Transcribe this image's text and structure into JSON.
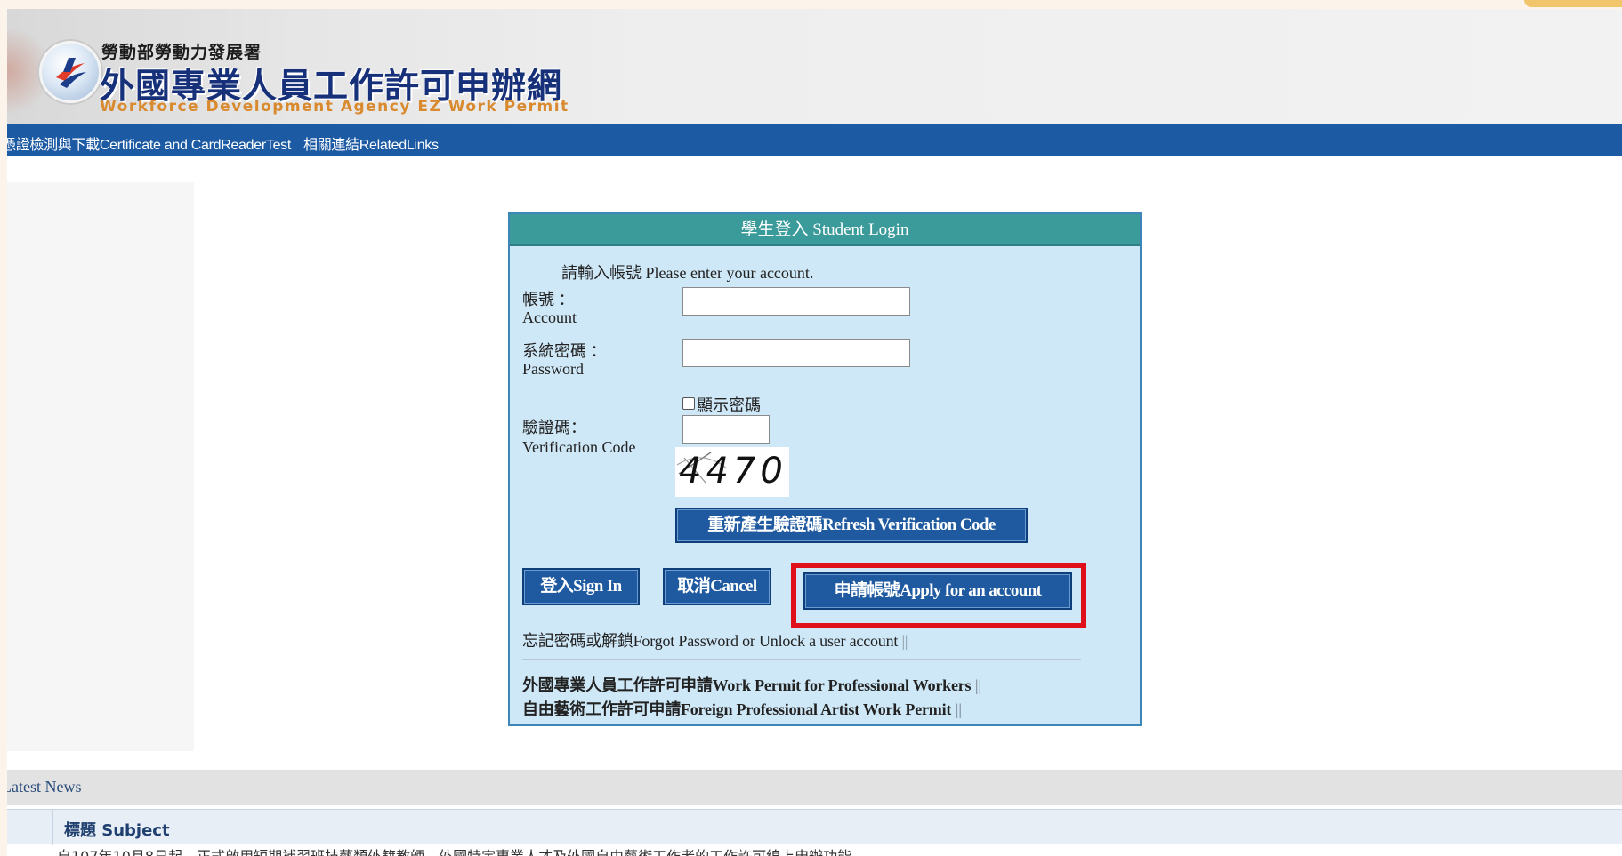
{
  "header": {
    "agency_name": "勞動部勞動力發展署",
    "site_title": "外國專業人員工作許可申辦網",
    "site_subtitle": "Workforce Development Agency EZ Work Permit"
  },
  "nav": {
    "certificate_link": "憑證檢測與下載Certificate and CardReaderTest",
    "related_links": "相關連結RelatedLinks"
  },
  "login": {
    "header": "學生登入 Student Login",
    "prompt": "請輸入帳號 Please enter your account.",
    "account_label_zh": "帳號 ：",
    "account_label_en": "Account",
    "account_value": "",
    "password_label_zh": "系統密碼 ：",
    "password_label_en": "Password",
    "password_value": "",
    "show_password_label": "顯示密碼",
    "verification_label_zh": "驗證碼：",
    "verification_label_en": "Verification Code",
    "verification_value": "",
    "captcha_text": "4470",
    "refresh_button": "重新產生驗證碼Refresh Verification Code",
    "sign_in_button": "登入Sign In",
    "cancel_button": "取消Cancel",
    "apply_button": "申請帳號Apply for an account",
    "forgot_password_link": "忘記密碼或解鎖Forgot Password or Unlock a user account",
    "work_permit_link": "外國專業人員工作許可申請Work Permit for Professional Workers",
    "artist_permit_link": "自由藝術工作許可申請Foreign Professional Artist Work Permit",
    "separator": "||"
  },
  "news": {
    "title": "Latest News",
    "subject_header": "標題 Subject",
    "first_item": "自107年10月8日起，正式啟用短期補習班技藝類外籍教師、外國特定專業人才及外國自由藝術工作者的工作許可線上申辦功能。"
  },
  "colors": {
    "navbar": "#1c5aa3",
    "login_header": "#3b9a9a",
    "login_bg": "#cfe8f7",
    "button": "#1f5aa0",
    "highlight": "#e0101a",
    "title_blue": "#17307a",
    "subtitle_orange": "#d98a2e"
  }
}
